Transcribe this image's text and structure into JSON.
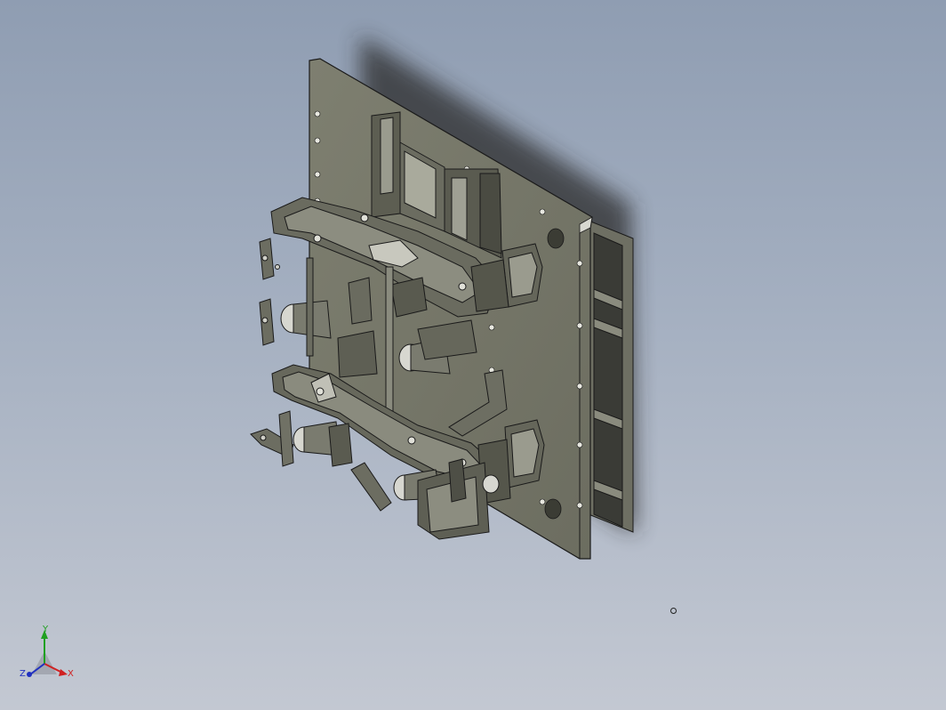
{
  "viewport": {
    "background_top": "#8f9db2",
    "background_bottom": "#c3c8d2"
  },
  "model": {
    "plate_color": "#777868",
    "frame_color": "#7a7b70",
    "edge_color": "#1a1a1a"
  },
  "triad": {
    "x_label": "X",
    "y_label": "Y",
    "z_label": "Z",
    "x_color": "#d02020",
    "y_color": "#20a020",
    "z_color": "#2030c0"
  }
}
